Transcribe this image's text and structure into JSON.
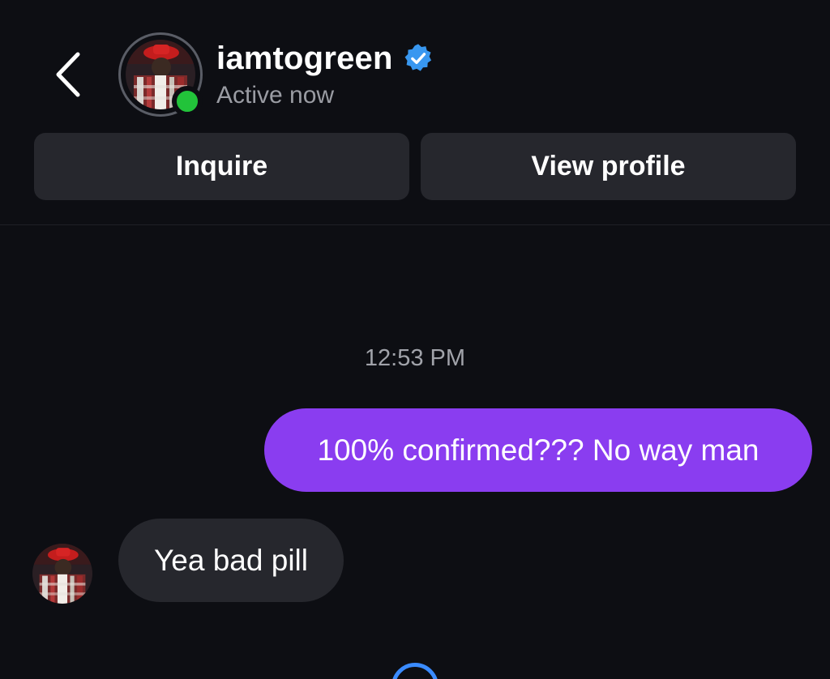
{
  "header": {
    "username": "iamtogreen",
    "status": "Active now",
    "verified": true,
    "online": true
  },
  "actions": {
    "inquire_label": "Inquire",
    "view_profile_label": "View profile"
  },
  "thread": {
    "timestamp": "12:53 PM",
    "messages": [
      {
        "direction": "outgoing",
        "text": "100% confirmed??? No way man"
      },
      {
        "direction": "incoming",
        "text": "Yea bad pill"
      }
    ]
  },
  "colors": {
    "background": "#0d0e13",
    "button": "#26272d",
    "outgoing_bubble": "#8a3df0",
    "incoming_bubble": "#26272d",
    "online": "#22c33a",
    "verified": "#3897f0",
    "secondary_text": "#9a9ca3"
  },
  "icons": {
    "back": "chevron-left-icon",
    "verified": "verified-badge-icon",
    "loading": "loading-spinner-icon"
  }
}
